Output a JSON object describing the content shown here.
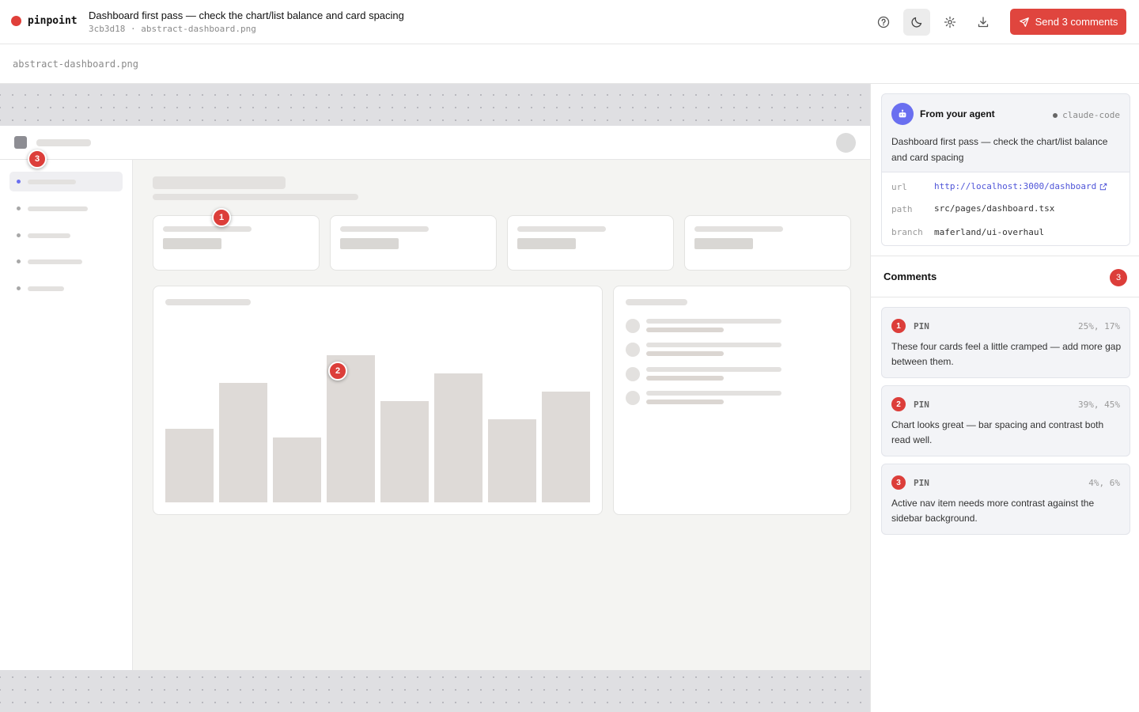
{
  "app": {
    "name": "pinpoint",
    "brand_color": "#e0403a"
  },
  "header": {
    "title": "Dashboard first pass — check the chart/list balance and card spacing",
    "subtitle": "3cb3d18 · abstract-dashboard.png",
    "icons": [
      "help-icon",
      "moon-icon",
      "gear-icon",
      "download-icon"
    ],
    "send_label": "Send 3 comments",
    "send_color": "#e0453e"
  },
  "file": {
    "name": "abstract-dashboard.png"
  },
  "canvas": {
    "pins": [
      {
        "number": "1"
      },
      {
        "number": "2"
      },
      {
        "number": "3"
      }
    ]
  },
  "agent": {
    "label": "From your agent",
    "tag": "claude-code",
    "message": "Dashboard first pass — check the chart/list balance and card spacing",
    "meta": [
      {
        "key": "url",
        "value": "http://localhost:3000/dashboard"
      },
      {
        "key": "path",
        "value": "src/pages/dashboard.tsx"
      },
      {
        "key": "branch",
        "value": "maferland/ui-overhaul"
      }
    ]
  },
  "comments": {
    "title": "Comments",
    "count": "3",
    "items": [
      {
        "number": "1",
        "kind": "PIN",
        "position": "25%, 17%",
        "text": "These four cards feel a little cramped — add more gap between them."
      },
      {
        "number": "2",
        "kind": "PIN",
        "position": "39%, 45%",
        "text": "Chart looks great — bar spacing and contrast both read well."
      },
      {
        "number": "3",
        "kind": "PIN",
        "position": "4%, 6%",
        "text": "Active nav item needs more contrast against the sidebar background."
      }
    ]
  }
}
